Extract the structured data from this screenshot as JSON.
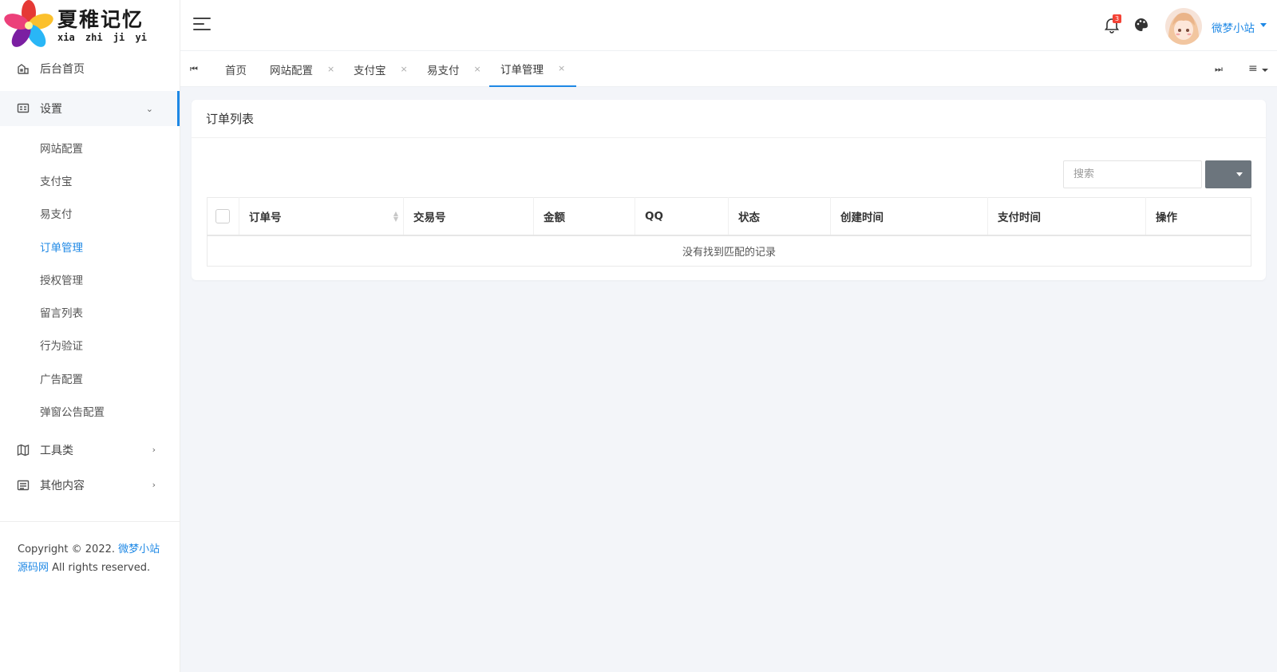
{
  "logo": {
    "title_cn": "夏稚记忆",
    "title_pinyin": "xia zhi ji yi"
  },
  "sidebar": {
    "menu": [
      {
        "label": "后台首页",
        "icon": "dashboard-icon"
      },
      {
        "label": "设置",
        "icon": "settings-card-icon",
        "expanded": true,
        "children": [
          "网站配置",
          "支付宝",
          "易支付",
          "订单管理",
          "授权管理",
          "留言列表",
          "行为验证",
          "广告配置",
          "弹窗公告配置"
        ],
        "active_child": "订单管理"
      },
      {
        "label": "工具类",
        "icon": "map-icon"
      },
      {
        "label": "其他内容",
        "icon": "list-icon"
      }
    ],
    "copyright": {
      "prefix": "Copyright © 2022. ",
      "link": "微梦小站源码网",
      "suffix": " All rights reserved."
    }
  },
  "header": {
    "notification_count": "3",
    "username": "微梦小站"
  },
  "tabs": [
    {
      "label": "首页",
      "closable": false
    },
    {
      "label": "网站配置",
      "closable": true,
      "close": "×"
    },
    {
      "label": "支付宝",
      "closable": true,
      "close": "×"
    },
    {
      "label": "易支付",
      "closable": true,
      "close": "×"
    },
    {
      "label": "订单管理",
      "closable": true,
      "close": "×",
      "active": true
    }
  ],
  "tab_controls": {
    "first": "⏮",
    "last": "⏭",
    "menu": "≡"
  },
  "card": {
    "title": "订单列表",
    "search_placeholder": "搜索",
    "columns": [
      "订单号",
      "交易号",
      "金额",
      "QQ",
      "状态",
      "创建时间",
      "支付时间",
      "操作"
    ],
    "empty_text": "没有找到匹配的记录"
  },
  "colors": {
    "accent": "#1e88e5",
    "badge": "#f44336",
    "button": "#6c757d"
  }
}
